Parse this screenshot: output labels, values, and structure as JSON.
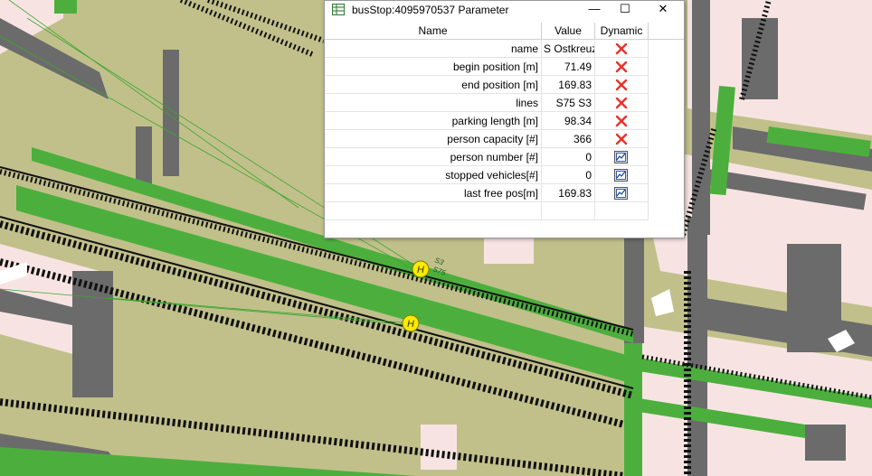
{
  "window": {
    "title": "busStop:4095970537 Parameter",
    "minimize_glyph": "—",
    "maximize_glyph": "☐",
    "close_glyph": "✕"
  },
  "table": {
    "headers": {
      "name": "Name",
      "value": "Value",
      "dynamic": "Dynamic"
    },
    "rows": [
      {
        "name": "name",
        "value": "S Ostkreuz",
        "dynamic": "x-icon"
      },
      {
        "name": "begin position [m]",
        "value": "71.49",
        "dynamic": "x-icon"
      },
      {
        "name": "end position [m]",
        "value": "169.83",
        "dynamic": "x-icon"
      },
      {
        "name": "lines",
        "value": "S75 S3",
        "dynamic": "x-icon"
      },
      {
        "name": "parking length [m]",
        "value": "98.34",
        "dynamic": "x-icon"
      },
      {
        "name": "person capacity [#]",
        "value": "366",
        "dynamic": "x-icon"
      },
      {
        "name": "person number [#]",
        "value": "0",
        "dynamic": "plot-icon"
      },
      {
        "name": "stopped vehicles[#]",
        "value": "0",
        "dynamic": "plot-icon"
      },
      {
        "name": "last free pos[m]",
        "value": "169.83",
        "dynamic": "plot-icon"
      },
      {
        "name": "",
        "value": "",
        "dynamic": ""
      }
    ]
  },
  "map": {
    "stop_label_lines": [
      "S3",
      "S75"
    ],
    "stop_marker_glyph": "H"
  },
  "colors": {
    "terrain": "#c1c08b",
    "residential": "#f7e4e2",
    "road_gray": "#696969",
    "rail_green": "#4caf3d",
    "stop_yellow": "#ffea00",
    "close_red": "#e8322a"
  }
}
